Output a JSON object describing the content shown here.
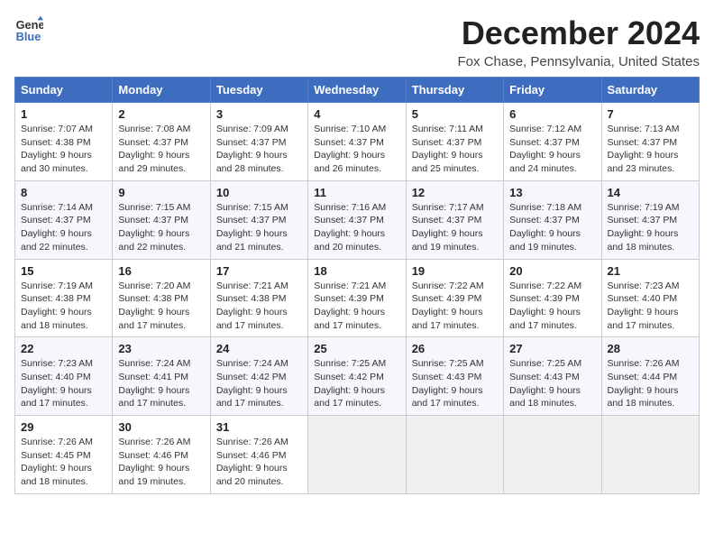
{
  "logo": {
    "line1": "General",
    "line2": "Blue"
  },
  "title": "December 2024",
  "subtitle": "Fox Chase, Pennsylvania, United States",
  "headers": [
    "Sunday",
    "Monday",
    "Tuesday",
    "Wednesday",
    "Thursday",
    "Friday",
    "Saturday"
  ],
  "weeks": [
    [
      {
        "day": "1",
        "sunrise": "Sunrise: 7:07 AM",
        "sunset": "Sunset: 4:38 PM",
        "daylight": "Daylight: 9 hours and 30 minutes."
      },
      {
        "day": "2",
        "sunrise": "Sunrise: 7:08 AM",
        "sunset": "Sunset: 4:37 PM",
        "daylight": "Daylight: 9 hours and 29 minutes."
      },
      {
        "day": "3",
        "sunrise": "Sunrise: 7:09 AM",
        "sunset": "Sunset: 4:37 PM",
        "daylight": "Daylight: 9 hours and 28 minutes."
      },
      {
        "day": "4",
        "sunrise": "Sunrise: 7:10 AM",
        "sunset": "Sunset: 4:37 PM",
        "daylight": "Daylight: 9 hours and 26 minutes."
      },
      {
        "day": "5",
        "sunrise": "Sunrise: 7:11 AM",
        "sunset": "Sunset: 4:37 PM",
        "daylight": "Daylight: 9 hours and 25 minutes."
      },
      {
        "day": "6",
        "sunrise": "Sunrise: 7:12 AM",
        "sunset": "Sunset: 4:37 PM",
        "daylight": "Daylight: 9 hours and 24 minutes."
      },
      {
        "day": "7",
        "sunrise": "Sunrise: 7:13 AM",
        "sunset": "Sunset: 4:37 PM",
        "daylight": "Daylight: 9 hours and 23 minutes."
      }
    ],
    [
      {
        "day": "8",
        "sunrise": "Sunrise: 7:14 AM",
        "sunset": "Sunset: 4:37 PM",
        "daylight": "Daylight: 9 hours and 22 minutes."
      },
      {
        "day": "9",
        "sunrise": "Sunrise: 7:15 AM",
        "sunset": "Sunset: 4:37 PM",
        "daylight": "Daylight: 9 hours and 22 minutes."
      },
      {
        "day": "10",
        "sunrise": "Sunrise: 7:15 AM",
        "sunset": "Sunset: 4:37 PM",
        "daylight": "Daylight: 9 hours and 21 minutes."
      },
      {
        "day": "11",
        "sunrise": "Sunrise: 7:16 AM",
        "sunset": "Sunset: 4:37 PM",
        "daylight": "Daylight: 9 hours and 20 minutes."
      },
      {
        "day": "12",
        "sunrise": "Sunrise: 7:17 AM",
        "sunset": "Sunset: 4:37 PM",
        "daylight": "Daylight: 9 hours and 19 minutes."
      },
      {
        "day": "13",
        "sunrise": "Sunrise: 7:18 AM",
        "sunset": "Sunset: 4:37 PM",
        "daylight": "Daylight: 9 hours and 19 minutes."
      },
      {
        "day": "14",
        "sunrise": "Sunrise: 7:19 AM",
        "sunset": "Sunset: 4:37 PM",
        "daylight": "Daylight: 9 hours and 18 minutes."
      }
    ],
    [
      {
        "day": "15",
        "sunrise": "Sunrise: 7:19 AM",
        "sunset": "Sunset: 4:38 PM",
        "daylight": "Daylight: 9 hours and 18 minutes."
      },
      {
        "day": "16",
        "sunrise": "Sunrise: 7:20 AM",
        "sunset": "Sunset: 4:38 PM",
        "daylight": "Daylight: 9 hours and 17 minutes."
      },
      {
        "day": "17",
        "sunrise": "Sunrise: 7:21 AM",
        "sunset": "Sunset: 4:38 PM",
        "daylight": "Daylight: 9 hours and 17 minutes."
      },
      {
        "day": "18",
        "sunrise": "Sunrise: 7:21 AM",
        "sunset": "Sunset: 4:39 PM",
        "daylight": "Daylight: 9 hours and 17 minutes."
      },
      {
        "day": "19",
        "sunrise": "Sunrise: 7:22 AM",
        "sunset": "Sunset: 4:39 PM",
        "daylight": "Daylight: 9 hours and 17 minutes."
      },
      {
        "day": "20",
        "sunrise": "Sunrise: 7:22 AM",
        "sunset": "Sunset: 4:39 PM",
        "daylight": "Daylight: 9 hours and 17 minutes."
      },
      {
        "day": "21",
        "sunrise": "Sunrise: 7:23 AM",
        "sunset": "Sunset: 4:40 PM",
        "daylight": "Daylight: 9 hours and 17 minutes."
      }
    ],
    [
      {
        "day": "22",
        "sunrise": "Sunrise: 7:23 AM",
        "sunset": "Sunset: 4:40 PM",
        "daylight": "Daylight: 9 hours and 17 minutes."
      },
      {
        "day": "23",
        "sunrise": "Sunrise: 7:24 AM",
        "sunset": "Sunset: 4:41 PM",
        "daylight": "Daylight: 9 hours and 17 minutes."
      },
      {
        "day": "24",
        "sunrise": "Sunrise: 7:24 AM",
        "sunset": "Sunset: 4:42 PM",
        "daylight": "Daylight: 9 hours and 17 minutes."
      },
      {
        "day": "25",
        "sunrise": "Sunrise: 7:25 AM",
        "sunset": "Sunset: 4:42 PM",
        "daylight": "Daylight: 9 hours and 17 minutes."
      },
      {
        "day": "26",
        "sunrise": "Sunrise: 7:25 AM",
        "sunset": "Sunset: 4:43 PM",
        "daylight": "Daylight: 9 hours and 17 minutes."
      },
      {
        "day": "27",
        "sunrise": "Sunrise: 7:25 AM",
        "sunset": "Sunset: 4:43 PM",
        "daylight": "Daylight: 9 hours and 18 minutes."
      },
      {
        "day": "28",
        "sunrise": "Sunrise: 7:26 AM",
        "sunset": "Sunset: 4:44 PM",
        "daylight": "Daylight: 9 hours and 18 minutes."
      }
    ],
    [
      {
        "day": "29",
        "sunrise": "Sunrise: 7:26 AM",
        "sunset": "Sunset: 4:45 PM",
        "daylight": "Daylight: 9 hours and 18 minutes."
      },
      {
        "day": "30",
        "sunrise": "Sunrise: 7:26 AM",
        "sunset": "Sunset: 4:46 PM",
        "daylight": "Daylight: 9 hours and 19 minutes."
      },
      {
        "day": "31",
        "sunrise": "Sunrise: 7:26 AM",
        "sunset": "Sunset: 4:46 PM",
        "daylight": "Daylight: 9 hours and 20 minutes."
      },
      null,
      null,
      null,
      null
    ]
  ]
}
